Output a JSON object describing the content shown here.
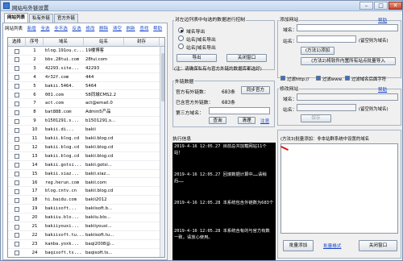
{
  "window": {
    "title": "网站与外链设置",
    "min": "–",
    "max": "□",
    "close": "✕"
  },
  "tabs": [
    "网站列表",
    "私有外链",
    "官方外链"
  ],
  "list_toolbar": {
    "label": "网站列表",
    "actions": [
      "新增",
      "全选",
      "全不选",
      "反选",
      "修改",
      "删除",
      "清空",
      "刷新",
      "查找",
      "帮助"
    ]
  },
  "table": {
    "headers": [
      "选择",
      "序号",
      "域名",
      "站名",
      "封存"
    ],
    "rows": [
      [
        "1",
        "blog.191ou.c...",
        "19楼博客"
      ],
      [
        "2",
        "bbs.28tui.com",
        "28tui.com"
      ],
      [
        "3",
        "42293.site...",
        "42293"
      ],
      [
        "4",
        "4r32f.com",
        "444"
      ],
      [
        "5",
        "bakii.5464.",
        "5464"
      ],
      [
        "6",
        "001.com",
        "58同城CMS2.2"
      ],
      [
        "7",
        "act.com",
        "act@email.0"
      ],
      [
        "8",
        "bat888.com",
        "Admin5产品"
      ],
      [
        "9",
        "b1501291.s...",
        "b1501291.s..."
      ],
      [
        "10",
        "bakii.di...",
        "bakii"
      ],
      [
        "11",
        "bakii.blog.cd",
        "bakii.blog.cd"
      ],
      [
        "12",
        "bakii.blog.cd",
        "bakii.blog.cd"
      ],
      [
        "13",
        "bakii.blog.cd",
        "bakii.blog.cd"
      ],
      [
        "14",
        "bakii.gotsi...",
        "bakii.gotsi..."
      ],
      [
        "15",
        "bakii.xiaz...",
        "bakii.xiaz..."
      ],
      [
        "16",
        "reg.herun.com",
        "bakii.com"
      ],
      [
        "17",
        "blog.cntv.cn",
        "bakii.blog.cd"
      ],
      [
        "18",
        "hi.baidu.com",
        "bakii2012"
      ],
      [
        "19",
        "bakiisoft...",
        "bakiisoft.b..."
      ],
      [
        "20",
        "bakiiu.blo...",
        "bakiiu.blo..."
      ],
      [
        "21",
        "bakiiyouxi...",
        "bakiiyouxi..."
      ],
      [
        "22",
        "bakiisoft.tu...",
        "bakiisoft.tu..."
      ],
      [
        "23",
        "kanba.yoxk...",
        "baqi2008@..."
      ],
      [
        "24",
        "baqisoft.ts...",
        "baqisoft.ts..."
      ]
    ]
  },
  "export_group": {
    "title": "对左边列表中勾选的数据进行控制",
    "options": [
      "域名导出",
      "站名|域名导出",
      "站名|域名导出"
    ],
    "selected": 0,
    "export_button": "导出",
    "close_button": "关闭窗口",
    "note": "(注：请确保私有与官方外链的数据库都选好)"
  },
  "ext_data": {
    "title": "外链数据",
    "official_label": "官方有外链数：",
    "official_count": "683条",
    "sync_button": "同步官方",
    "included_label": "已含官方外链数：",
    "included_count": "683条",
    "third_label": "第三方域名：",
    "query_button": "查询",
    "clear_button": "清理",
    "note_link": "注意"
  },
  "add_site": {
    "title": "添加网站",
    "help": "帮助",
    "domain_label": "域名：",
    "name_label": "站名：",
    "name_hint": "(留空则为域名)",
    "method1_button": "(方法1)添加",
    "method2_button": "(方法2)将软件内置所有站点批量导入",
    "filters": [
      "过滤http://",
      "过滤www.",
      "过滤域名后面字符"
    ]
  },
  "edit_site": {
    "title": "修改网站",
    "help": "帮助",
    "domain_label": "域名：",
    "name_label": "站名：",
    "name_hint": "(留空则为域名)",
    "save_button": "保存"
  },
  "exec_info": {
    "title": "执行信息",
    "log": [
      "2019-4-16 12:05.27  目前总共加载网站11个站！",
      "2019-4-16 12:05.27  回滚数据计算中……请稍后……",
      "2019-4-16 12:05.28  本系统包含外链数为683个",
      "2019-4-16 12:05.28  本系统含有的与官方有数一致，请放心使用。"
    ]
  },
  "batch": {
    "label": "(方法3)批量添加：非本站群系统中设置的域名",
    "add_button": "批量添加",
    "format_link": "批量格式",
    "close_button": "关闭窗口"
  }
}
